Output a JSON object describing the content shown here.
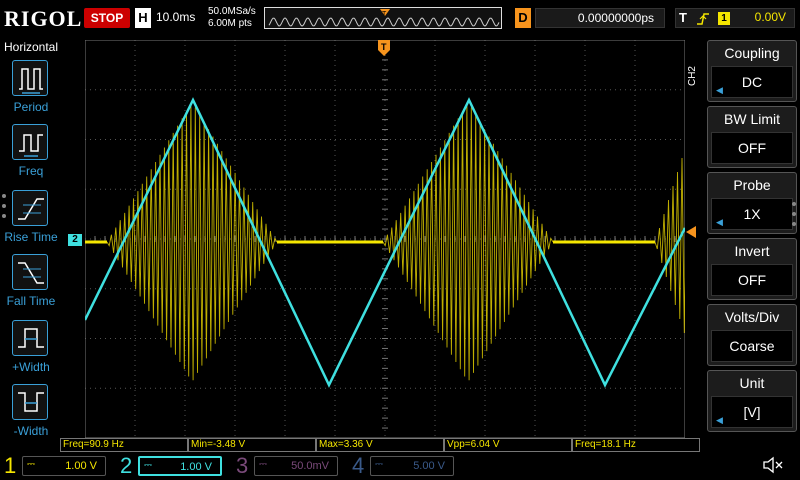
{
  "top": {
    "logo": "RIGOL",
    "run_state": "STOP",
    "horizontal_badge": "H",
    "timebase": "10.0ms",
    "sample_rate": "50.0MSa/s",
    "memory_depth": "6.00M pts",
    "trigger_marker": "T",
    "delay_badge": "D",
    "delay_value": "0.00000000ps",
    "trigger_badge": "T",
    "trigger_edge": "rising-edge",
    "trigger_source": "1",
    "trigger_level": "0.00V"
  },
  "left_menu": {
    "title": "Horizontal",
    "items": [
      {
        "label": "Period",
        "icon": "period-icon"
      },
      {
        "label": "Freq",
        "icon": "frequency-icon"
      },
      {
        "label": "Rise Time",
        "icon": "rise-time-icon"
      },
      {
        "label": "Fall Time",
        "icon": "fall-time-icon"
      },
      {
        "label": "+Width",
        "icon": "positive-width-icon"
      },
      {
        "label": "-Width",
        "icon": "negative-width-icon"
      }
    ]
  },
  "right_menu": {
    "channel": "CH2",
    "items": [
      {
        "title": "Coupling",
        "value": "DC",
        "has_arrow": true
      },
      {
        "title": "BW Limit",
        "value": "OFF",
        "has_arrow": false
      },
      {
        "title": "Probe",
        "value": "1X",
        "has_arrow": true
      },
      {
        "title": "Invert",
        "value": "OFF",
        "has_arrow": false
      },
      {
        "title": "Volts/Div",
        "value": "Coarse",
        "has_arrow": false
      },
      {
        "title": "Unit",
        "value": "[V]",
        "has_arrow": true
      }
    ]
  },
  "markers": {
    "ch2_level": "2"
  },
  "measurements": [
    {
      "label": "Freq=90.9 Hz"
    },
    {
      "label": "Min=-3.48 V"
    },
    {
      "label": "Max=3.36 V"
    },
    {
      "label": "Vpp=6.04 V"
    },
    {
      "label": "Freq=18.1 Hz"
    }
  ],
  "channels": [
    {
      "num": "1",
      "coupling": "DC",
      "scale": "1.00 V",
      "color": "#f5e600"
    },
    {
      "num": "2",
      "coupling": "DC",
      "scale": "1.00 V",
      "color": "#3fe0e0"
    },
    {
      "num": "3",
      "coupling": "DC",
      "scale": "50.0mV",
      "color": "#7a4a7a"
    },
    {
      "num": "4",
      "coupling": "DC",
      "scale": "5.00 V",
      "color": "#3a5a8a"
    }
  ],
  "speaker_icon": "speaker-muted-icon",
  "colors": {
    "ch1": "#f5e600",
    "ch2": "#3fe0e0",
    "accent": "#3aa0d8",
    "stop": "#cc0000",
    "delay": "#f7941d"
  }
}
